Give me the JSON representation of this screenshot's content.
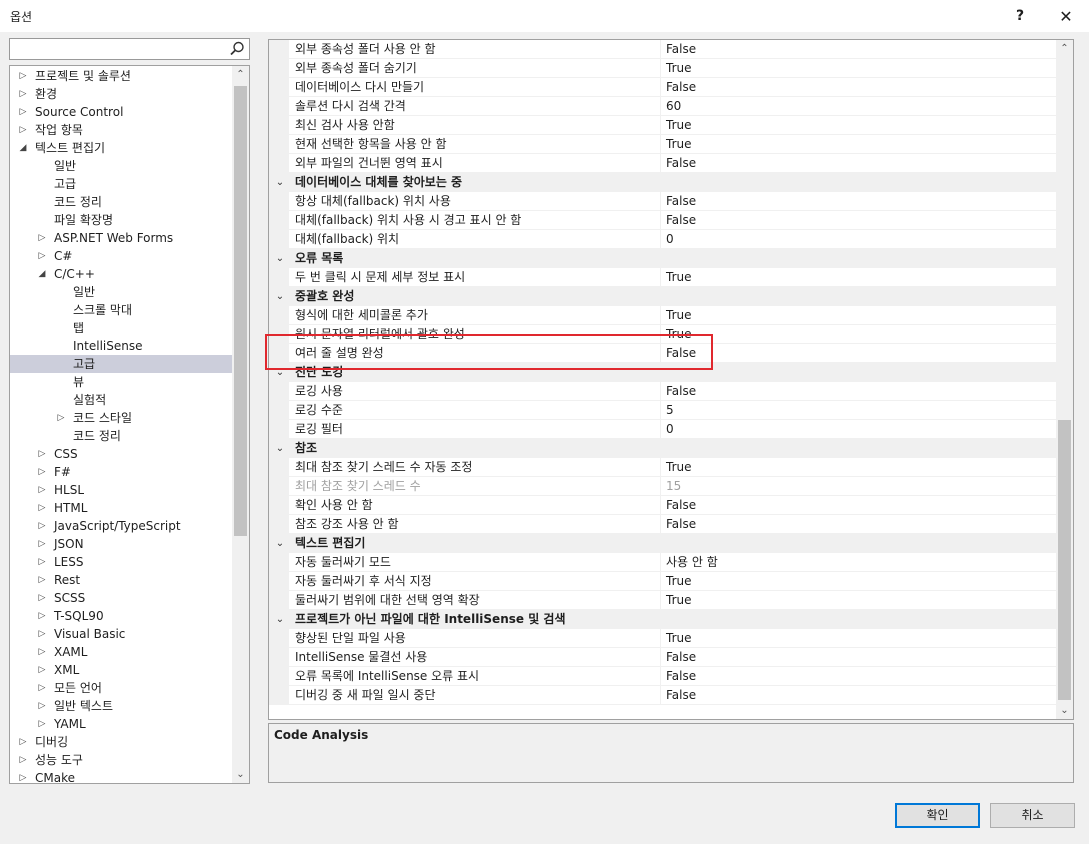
{
  "dialog": {
    "title": "옵션",
    "help": "?",
    "close": "✕"
  },
  "search": {
    "value": "",
    "placeholder": ""
  },
  "tree": [
    {
      "label": "프로젝트 및 솔루션",
      "level": 0,
      "exp": "right"
    },
    {
      "label": "환경",
      "level": 0,
      "exp": "right"
    },
    {
      "label": "Source Control",
      "level": 0,
      "exp": "right"
    },
    {
      "label": "작업 항목",
      "level": 0,
      "exp": "right"
    },
    {
      "label": "텍스트 편집기",
      "level": 0,
      "exp": "down"
    },
    {
      "label": "일반",
      "level": 1,
      "exp": ""
    },
    {
      "label": "고급",
      "level": 1,
      "exp": ""
    },
    {
      "label": "코드 정리",
      "level": 1,
      "exp": ""
    },
    {
      "label": "파일 확장명",
      "level": 1,
      "exp": ""
    },
    {
      "label": "ASP.NET Web Forms",
      "level": 1,
      "exp": "right"
    },
    {
      "label": "C#",
      "level": 1,
      "exp": "right"
    },
    {
      "label": "C/C++",
      "level": 1,
      "exp": "down"
    },
    {
      "label": "일반",
      "level": 2,
      "exp": ""
    },
    {
      "label": "스크롤 막대",
      "level": 2,
      "exp": ""
    },
    {
      "label": "탭",
      "level": 2,
      "exp": ""
    },
    {
      "label": "IntelliSense",
      "level": 2,
      "exp": ""
    },
    {
      "label": "고급",
      "level": 2,
      "exp": "",
      "selected": true
    },
    {
      "label": "뷰",
      "level": 2,
      "exp": ""
    },
    {
      "label": "실험적",
      "level": 2,
      "exp": ""
    },
    {
      "label": "코드 스타일",
      "level": 2,
      "exp": "right"
    },
    {
      "label": "코드 정리",
      "level": 2,
      "exp": ""
    },
    {
      "label": "CSS",
      "level": 1,
      "exp": "right"
    },
    {
      "label": "F#",
      "level": 1,
      "exp": "right"
    },
    {
      "label": "HLSL",
      "level": 1,
      "exp": "right"
    },
    {
      "label": "HTML",
      "level": 1,
      "exp": "right"
    },
    {
      "label": "JavaScript/TypeScript",
      "level": 1,
      "exp": "right"
    },
    {
      "label": "JSON",
      "level": 1,
      "exp": "right"
    },
    {
      "label": "LESS",
      "level": 1,
      "exp": "right"
    },
    {
      "label": "Rest",
      "level": 1,
      "exp": "right"
    },
    {
      "label": "SCSS",
      "level": 1,
      "exp": "right"
    },
    {
      "label": "T-SQL90",
      "level": 1,
      "exp": "right"
    },
    {
      "label": "Visual Basic",
      "level": 1,
      "exp": "right"
    },
    {
      "label": "XAML",
      "level": 1,
      "exp": "right"
    },
    {
      "label": "XML",
      "level": 1,
      "exp": "right"
    },
    {
      "label": "모든 언어",
      "level": 1,
      "exp": "right"
    },
    {
      "label": "일반 텍스트",
      "level": 1,
      "exp": "right"
    },
    {
      "label": "YAML",
      "level": 1,
      "exp": "right"
    },
    {
      "label": "디버깅",
      "level": 0,
      "exp": "right"
    },
    {
      "label": "성능 도구",
      "level": 0,
      "exp": "right"
    },
    {
      "label": "CMake",
      "level": 0,
      "exp": "right"
    }
  ],
  "grid": [
    {
      "type": "prop",
      "name": "외부 종속성 폴더 사용 안 함",
      "value": "False"
    },
    {
      "type": "prop",
      "name": "외부 종속성 폴더 숨기기",
      "value": "True"
    },
    {
      "type": "prop",
      "name": "데이터베이스 다시 만들기",
      "value": "False"
    },
    {
      "type": "prop",
      "name": "솔루션 다시 검색 간격",
      "value": "60"
    },
    {
      "type": "prop",
      "name": "최신 검사 사용 안함",
      "value": "True"
    },
    {
      "type": "prop",
      "name": "현재 선택한 항목을 사용 안 함",
      "value": "True"
    },
    {
      "type": "prop",
      "name": "외부 파일의 건너뛴 영역 표시",
      "value": "False"
    },
    {
      "type": "cat",
      "name": "데이터베이스 대체를 찾아보는 중"
    },
    {
      "type": "prop",
      "name": "항상 대체(fallback) 위치 사용",
      "value": "False"
    },
    {
      "type": "prop",
      "name": "대체(fallback) 위치 사용 시 경고 표시 안 함",
      "value": "False"
    },
    {
      "type": "prop",
      "name": "대체(fallback) 위치",
      "value": "0"
    },
    {
      "type": "cat",
      "name": "오류 목록"
    },
    {
      "type": "prop",
      "name": "두 번 클릭 시 문제 세부 정보 표시",
      "value": "True"
    },
    {
      "type": "cat",
      "name": "중괄호 완성"
    },
    {
      "type": "prop",
      "name": "형식에 대한 세미콜론 추가",
      "value": "True"
    },
    {
      "type": "prop",
      "name": "원시 문자열 리터럴에서 괄호 완성",
      "value": "True"
    },
    {
      "type": "prop",
      "name": "여러 줄 설명 완성",
      "value": "False"
    },
    {
      "type": "cat",
      "name": "진단 도킹"
    },
    {
      "type": "prop",
      "name": "로깅 사용",
      "value": "False"
    },
    {
      "type": "prop",
      "name": "로깅 수준",
      "value": "5"
    },
    {
      "type": "prop",
      "name": "로깅 필터",
      "value": "0"
    },
    {
      "type": "cat",
      "name": "참조"
    },
    {
      "type": "prop",
      "name": "최대 참조 찾기 스레드 수 자동 조정",
      "value": "True"
    },
    {
      "type": "prop",
      "name": "최대 참조 찾기 스레드 수",
      "value": "15",
      "disabled": true
    },
    {
      "type": "prop",
      "name": "확인 사용 안 함",
      "value": "False"
    },
    {
      "type": "prop",
      "name": "참조 강조 사용 안 함",
      "value": "False"
    },
    {
      "type": "cat",
      "name": "텍스트 편집기"
    },
    {
      "type": "prop",
      "name": "자동 둘러싸기 모드",
      "value": "사용 안 함"
    },
    {
      "type": "prop",
      "name": "자동 둘러싸기 후 서식 지정",
      "value": "True"
    },
    {
      "type": "prop",
      "name": "둘러싸기 범위에 대한 선택 영역 확장",
      "value": "True"
    },
    {
      "type": "cat",
      "name": "프로젝트가 아닌 파일에 대한 IntelliSense 및 검색"
    },
    {
      "type": "prop",
      "name": "향상된 단일 파일 사용",
      "value": "True"
    },
    {
      "type": "prop",
      "name": "IntelliSense 물결선 사용",
      "value": "False"
    },
    {
      "type": "prop",
      "name": "오류 목록에 IntelliSense 오류 표시",
      "value": "False"
    },
    {
      "type": "prop",
      "name": "디버깅 중 새 파일 일시 중단",
      "value": "False"
    }
  ],
  "description": {
    "title": "Code Analysis"
  },
  "buttons": {
    "ok": "확인",
    "cancel": "취소"
  }
}
